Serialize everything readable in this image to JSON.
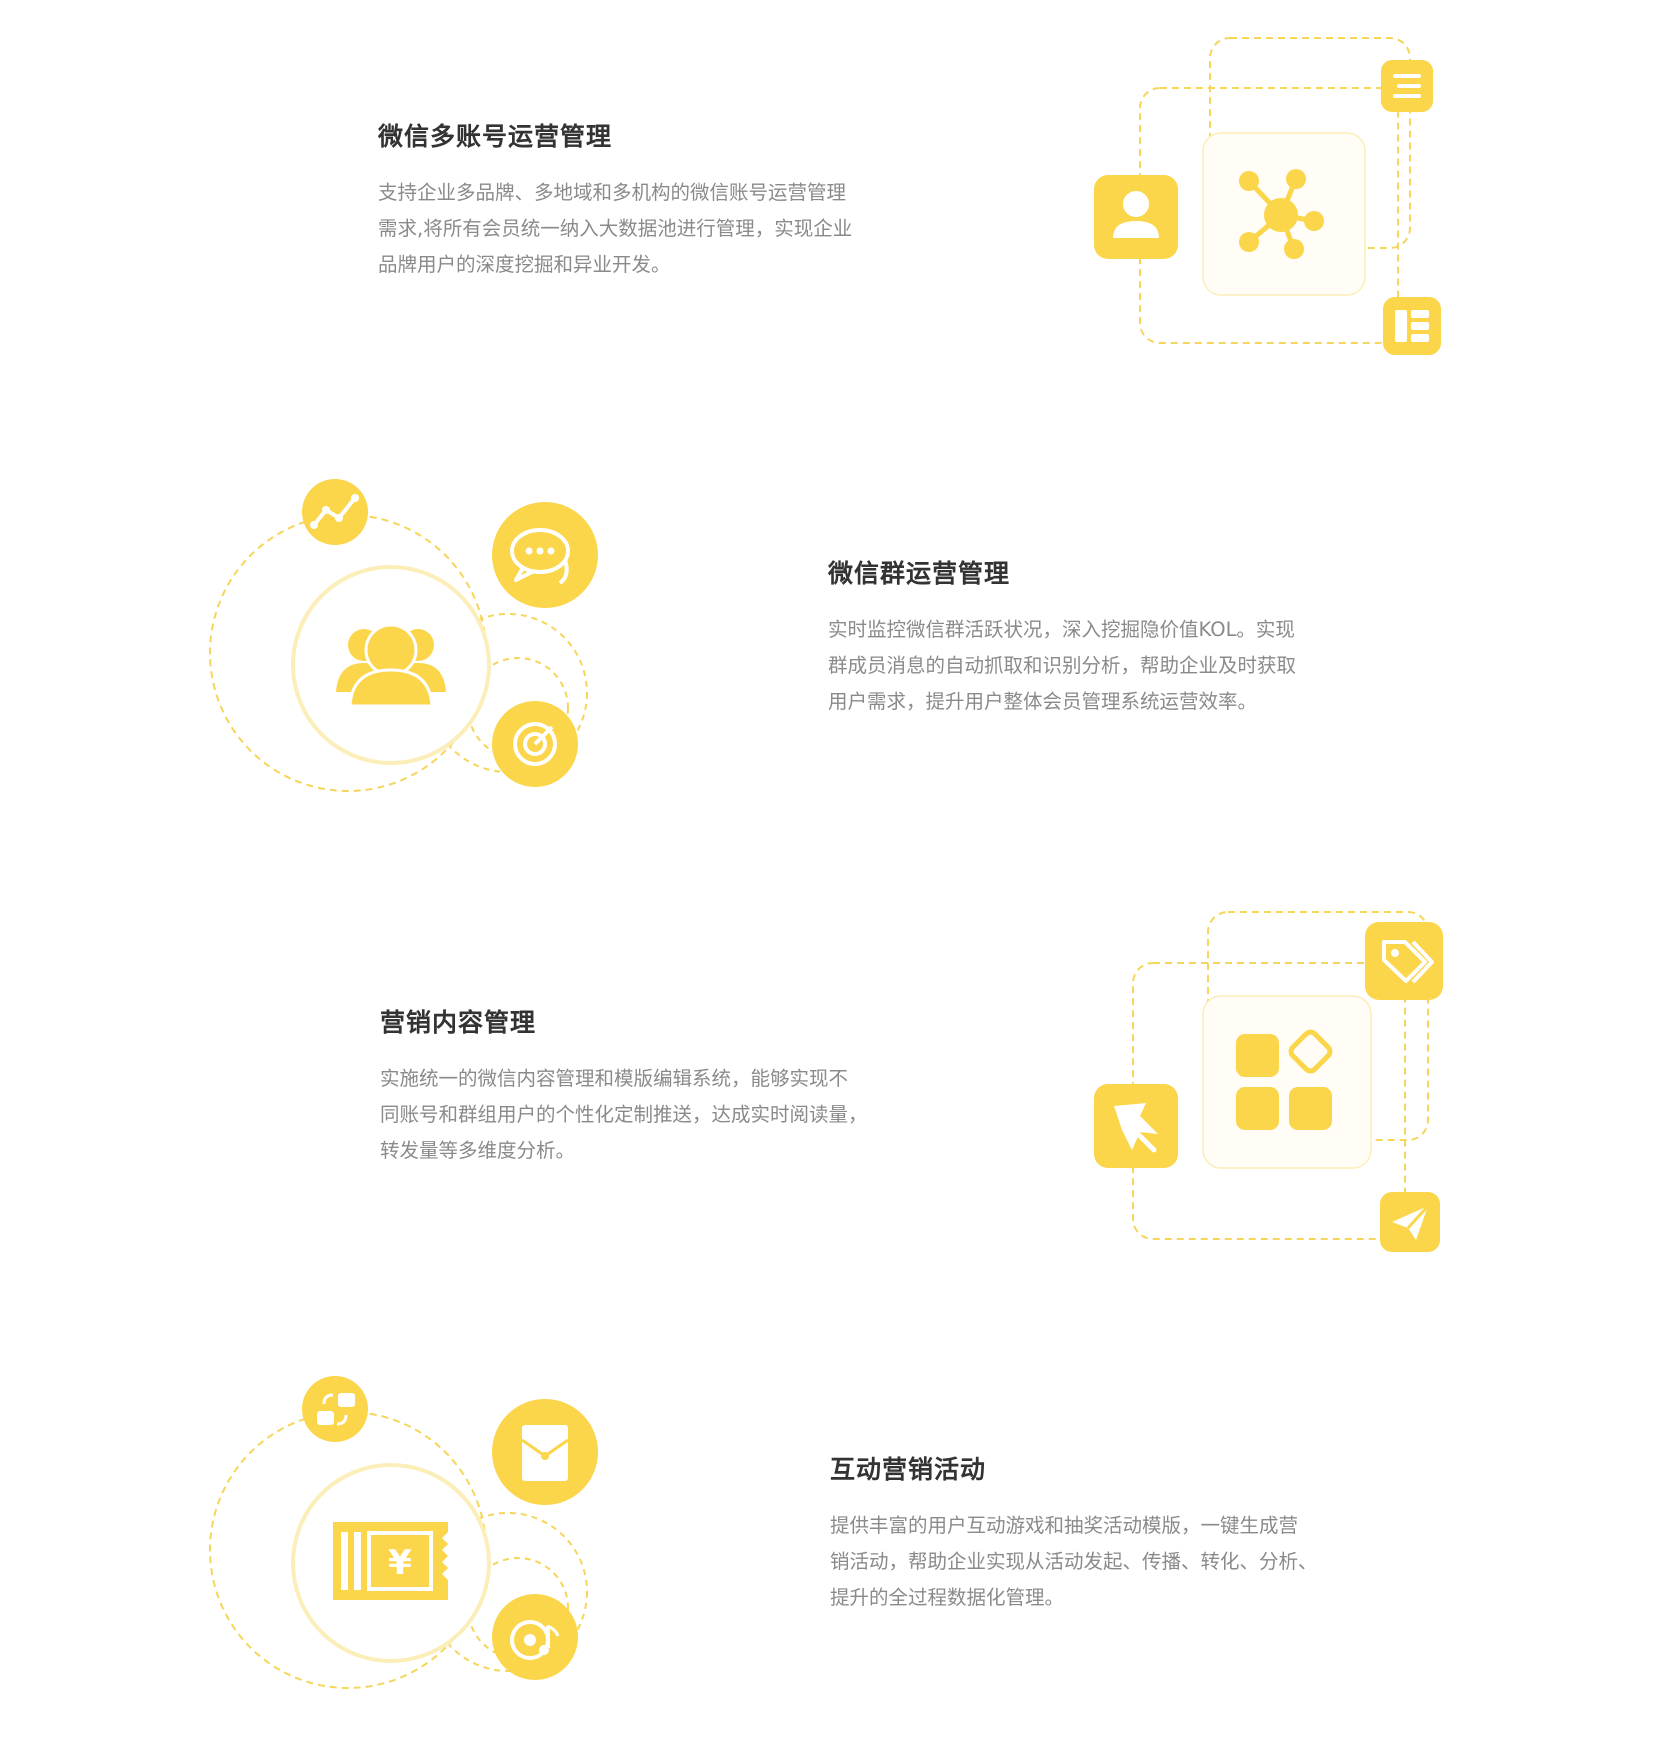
{
  "colors": {
    "accent": "#fbd54a",
    "dashed": "#f5d65a",
    "title": "#333333",
    "text": "#8a8a8a",
    "tile": "#fffdf3"
  },
  "sections": [
    {
      "title": "微信多账号运营管理",
      "lines": [
        "支持企业多品牌、多地域和多机构的微信账号运营管理",
        "需求,将所有会员统一纳入大数据池进行管理，实现企业",
        "品牌用户的深度挖掘和异业开发。"
      ],
      "icons": [
        "network-icon",
        "user-icon",
        "list-icon",
        "layout-icon"
      ]
    },
    {
      "title": "微信群运营管理",
      "lines": [
        "实时监控微信群活跃状况，深入挖掘隐价值KOL。实现",
        "群成员消息的自动抓取和识别分析，帮助企业及时获取",
        "用户需求，提升用户整体会员管理系统运营效率。"
      ],
      "icons": [
        "group-icon",
        "trend-icon",
        "chat-icon",
        "target-icon"
      ]
    },
    {
      "title": "营销内容管理",
      "lines": [
        "实施统一的微信内容管理和模版编辑系统，能够实现不",
        "同账号和群组用户的个性化定制推送，达成实时阅读量，",
        "转发量等多维度分析。"
      ],
      "icons": [
        "apps-icon",
        "tag-icon",
        "pin-icon",
        "send-icon"
      ]
    },
    {
      "title": "互动营销活动",
      "lines": [
        "提供丰富的用户互动游戏和抽奖活动模版，一键生成营",
        "销活动，帮助企业实现从活动发起、传播、转化、分析、",
        "提升的全过程数据化管理。"
      ],
      "icons": [
        "coupon-icon",
        "exchange-icon",
        "envelope-icon",
        "music-icon"
      ]
    }
  ]
}
